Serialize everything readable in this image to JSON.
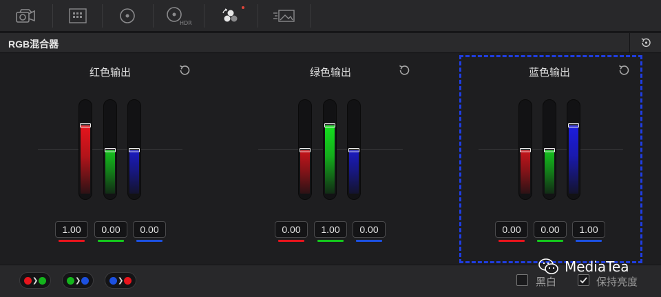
{
  "toolbar": {
    "tools": [
      {
        "icon": "camera-raw-icon"
      },
      {
        "icon": "color-match-icon"
      },
      {
        "icon": "color-wheels-icon"
      },
      {
        "icon": "hdr-wheels-icon",
        "text": "HDR"
      },
      {
        "icon": "rgb-mixer-icon",
        "active": true
      },
      {
        "icon": "motion-effects-icon"
      }
    ]
  },
  "header": {
    "title": "RGB混合器",
    "reset_icon": "reset-icon"
  },
  "groups": [
    {
      "title": "红色输出",
      "channels": [
        {
          "channel": "red",
          "value": "1.00",
          "level": 1.0
        },
        {
          "channel": "green",
          "value": "0.00",
          "level": 0.0
        },
        {
          "channel": "blue",
          "value": "0.00",
          "level": 0.0
        }
      ]
    },
    {
      "title": "绿色输出",
      "channels": [
        {
          "channel": "red",
          "value": "0.00",
          "level": 0.0
        },
        {
          "channel": "green",
          "value": "1.00",
          "level": 1.0
        },
        {
          "channel": "blue",
          "value": "0.00",
          "level": 0.0
        }
      ]
    },
    {
      "title": "蓝色输出",
      "channels": [
        {
          "channel": "red",
          "value": "0.00",
          "level": 0.0
        },
        {
          "channel": "green",
          "value": "0.00",
          "level": 0.0
        },
        {
          "channel": "blue",
          "value": "1.00",
          "level": 1.0
        }
      ]
    }
  ],
  "colors": {
    "red": "#e8141c",
    "green": "#14e01e",
    "blue": "#1c1ce0",
    "selection": "#1f3de0"
  },
  "footer": {
    "swap_buttons": [
      {
        "name": "swap-red-green",
        "from": "red",
        "to": "green"
      },
      {
        "name": "swap-green-blue",
        "from": "green",
        "to": "blue"
      },
      {
        "name": "swap-blue-red",
        "from": "blue",
        "to": "red"
      }
    ],
    "monochrome": {
      "label": "黑白",
      "checked": false
    },
    "preserve_luminance": {
      "label": "保持亮度",
      "checked": true
    }
  },
  "watermark": {
    "text": "MediaTea"
  }
}
